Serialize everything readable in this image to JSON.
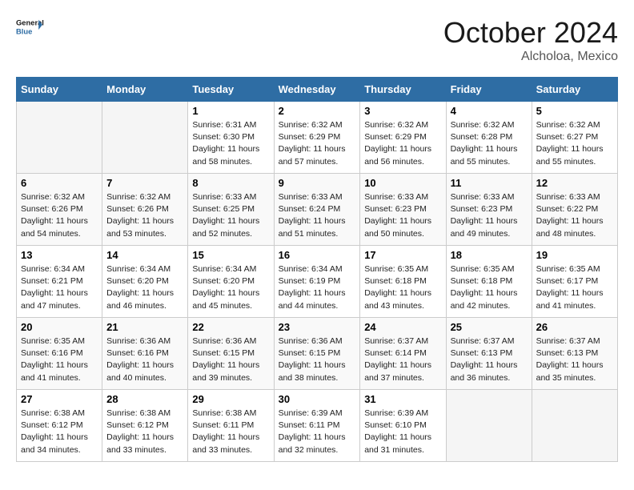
{
  "header": {
    "logo_general": "General",
    "logo_blue": "Blue",
    "month": "October 2024",
    "location": "Alcholoa, Mexico"
  },
  "days_of_week": [
    "Sunday",
    "Monday",
    "Tuesday",
    "Wednesday",
    "Thursday",
    "Friday",
    "Saturday"
  ],
  "weeks": [
    [
      {
        "day": "",
        "sunrise": "",
        "sunset": "",
        "daylight": ""
      },
      {
        "day": "",
        "sunrise": "",
        "sunset": "",
        "daylight": ""
      },
      {
        "day": "1",
        "sunrise": "Sunrise: 6:31 AM",
        "sunset": "Sunset: 6:30 PM",
        "daylight": "Daylight: 11 hours and 58 minutes."
      },
      {
        "day": "2",
        "sunrise": "Sunrise: 6:32 AM",
        "sunset": "Sunset: 6:29 PM",
        "daylight": "Daylight: 11 hours and 57 minutes."
      },
      {
        "day": "3",
        "sunrise": "Sunrise: 6:32 AM",
        "sunset": "Sunset: 6:29 PM",
        "daylight": "Daylight: 11 hours and 56 minutes."
      },
      {
        "day": "4",
        "sunrise": "Sunrise: 6:32 AM",
        "sunset": "Sunset: 6:28 PM",
        "daylight": "Daylight: 11 hours and 55 minutes."
      },
      {
        "day": "5",
        "sunrise": "Sunrise: 6:32 AM",
        "sunset": "Sunset: 6:27 PM",
        "daylight": "Daylight: 11 hours and 55 minutes."
      }
    ],
    [
      {
        "day": "6",
        "sunrise": "Sunrise: 6:32 AM",
        "sunset": "Sunset: 6:26 PM",
        "daylight": "Daylight: 11 hours and 54 minutes."
      },
      {
        "day": "7",
        "sunrise": "Sunrise: 6:32 AM",
        "sunset": "Sunset: 6:26 PM",
        "daylight": "Daylight: 11 hours and 53 minutes."
      },
      {
        "day": "8",
        "sunrise": "Sunrise: 6:33 AM",
        "sunset": "Sunset: 6:25 PM",
        "daylight": "Daylight: 11 hours and 52 minutes."
      },
      {
        "day": "9",
        "sunrise": "Sunrise: 6:33 AM",
        "sunset": "Sunset: 6:24 PM",
        "daylight": "Daylight: 11 hours and 51 minutes."
      },
      {
        "day": "10",
        "sunrise": "Sunrise: 6:33 AM",
        "sunset": "Sunset: 6:23 PM",
        "daylight": "Daylight: 11 hours and 50 minutes."
      },
      {
        "day": "11",
        "sunrise": "Sunrise: 6:33 AM",
        "sunset": "Sunset: 6:23 PM",
        "daylight": "Daylight: 11 hours and 49 minutes."
      },
      {
        "day": "12",
        "sunrise": "Sunrise: 6:33 AM",
        "sunset": "Sunset: 6:22 PM",
        "daylight": "Daylight: 11 hours and 48 minutes."
      }
    ],
    [
      {
        "day": "13",
        "sunrise": "Sunrise: 6:34 AM",
        "sunset": "Sunset: 6:21 PM",
        "daylight": "Daylight: 11 hours and 47 minutes."
      },
      {
        "day": "14",
        "sunrise": "Sunrise: 6:34 AM",
        "sunset": "Sunset: 6:20 PM",
        "daylight": "Daylight: 11 hours and 46 minutes."
      },
      {
        "day": "15",
        "sunrise": "Sunrise: 6:34 AM",
        "sunset": "Sunset: 6:20 PM",
        "daylight": "Daylight: 11 hours and 45 minutes."
      },
      {
        "day": "16",
        "sunrise": "Sunrise: 6:34 AM",
        "sunset": "Sunset: 6:19 PM",
        "daylight": "Daylight: 11 hours and 44 minutes."
      },
      {
        "day": "17",
        "sunrise": "Sunrise: 6:35 AM",
        "sunset": "Sunset: 6:18 PM",
        "daylight": "Daylight: 11 hours and 43 minutes."
      },
      {
        "day": "18",
        "sunrise": "Sunrise: 6:35 AM",
        "sunset": "Sunset: 6:18 PM",
        "daylight": "Daylight: 11 hours and 42 minutes."
      },
      {
        "day": "19",
        "sunrise": "Sunrise: 6:35 AM",
        "sunset": "Sunset: 6:17 PM",
        "daylight": "Daylight: 11 hours and 41 minutes."
      }
    ],
    [
      {
        "day": "20",
        "sunrise": "Sunrise: 6:35 AM",
        "sunset": "Sunset: 6:16 PM",
        "daylight": "Daylight: 11 hours and 41 minutes."
      },
      {
        "day": "21",
        "sunrise": "Sunrise: 6:36 AM",
        "sunset": "Sunset: 6:16 PM",
        "daylight": "Daylight: 11 hours and 40 minutes."
      },
      {
        "day": "22",
        "sunrise": "Sunrise: 6:36 AM",
        "sunset": "Sunset: 6:15 PM",
        "daylight": "Daylight: 11 hours and 39 minutes."
      },
      {
        "day": "23",
        "sunrise": "Sunrise: 6:36 AM",
        "sunset": "Sunset: 6:15 PM",
        "daylight": "Daylight: 11 hours and 38 minutes."
      },
      {
        "day": "24",
        "sunrise": "Sunrise: 6:37 AM",
        "sunset": "Sunset: 6:14 PM",
        "daylight": "Daylight: 11 hours and 37 minutes."
      },
      {
        "day": "25",
        "sunrise": "Sunrise: 6:37 AM",
        "sunset": "Sunset: 6:13 PM",
        "daylight": "Daylight: 11 hours and 36 minutes."
      },
      {
        "day": "26",
        "sunrise": "Sunrise: 6:37 AM",
        "sunset": "Sunset: 6:13 PM",
        "daylight": "Daylight: 11 hours and 35 minutes."
      }
    ],
    [
      {
        "day": "27",
        "sunrise": "Sunrise: 6:38 AM",
        "sunset": "Sunset: 6:12 PM",
        "daylight": "Daylight: 11 hours and 34 minutes."
      },
      {
        "day": "28",
        "sunrise": "Sunrise: 6:38 AM",
        "sunset": "Sunset: 6:12 PM",
        "daylight": "Daylight: 11 hours and 33 minutes."
      },
      {
        "day": "29",
        "sunrise": "Sunrise: 6:38 AM",
        "sunset": "Sunset: 6:11 PM",
        "daylight": "Daylight: 11 hours and 33 minutes."
      },
      {
        "day": "30",
        "sunrise": "Sunrise: 6:39 AM",
        "sunset": "Sunset: 6:11 PM",
        "daylight": "Daylight: 11 hours and 32 minutes."
      },
      {
        "day": "31",
        "sunrise": "Sunrise: 6:39 AM",
        "sunset": "Sunset: 6:10 PM",
        "daylight": "Daylight: 11 hours and 31 minutes."
      },
      {
        "day": "",
        "sunrise": "",
        "sunset": "",
        "daylight": ""
      },
      {
        "day": "",
        "sunrise": "",
        "sunset": "",
        "daylight": ""
      }
    ]
  ]
}
